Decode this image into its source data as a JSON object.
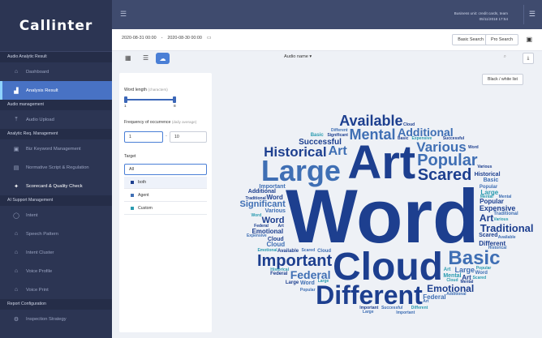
{
  "app": {
    "logo": "Callinter"
  },
  "topbar": {
    "user_line1": "Business unit: credit cards, team",
    "user_line2": "05/11/2018 17:54"
  },
  "sidebar": {
    "sections": [
      {
        "title": "Audio Analytic Result",
        "items": [
          {
            "label": "Dashboard",
            "icon": "home-icon",
            "glyph": "⌂"
          },
          {
            "label": "Analysis Result",
            "icon": "chart-icon",
            "glyph": "▟",
            "active": true
          }
        ]
      },
      {
        "title": "Audio management",
        "items": [
          {
            "label": "Audio Upload",
            "icon": "upload-icon",
            "glyph": "⤒"
          }
        ]
      },
      {
        "title": "Analytic Req. Management",
        "items": [
          {
            "label": "Biz Keyword Management",
            "icon": "keyword-icon",
            "glyph": "▣"
          },
          {
            "label": "Normative Script & Regulation",
            "icon": "script-icon",
            "glyph": "▤"
          },
          {
            "label": "Scorecard & Quality Check",
            "icon": "scorecard-icon",
            "glyph": "✦",
            "bright": true
          }
        ]
      },
      {
        "title": "AI Support Management",
        "items": [
          {
            "label": "Intent",
            "icon": "intent-icon",
            "glyph": "◯"
          },
          {
            "label": "Speech Pattern",
            "icon": "speech-pattern-icon",
            "glyph": "⌂"
          },
          {
            "label": "Intent Cluster",
            "icon": "cluster-icon",
            "glyph": "⌂"
          },
          {
            "label": "Voice Profile",
            "icon": "voice-profile-icon",
            "glyph": "⌂"
          },
          {
            "label": "Voice Print",
            "icon": "voice-print-icon",
            "glyph": "⌂"
          }
        ]
      },
      {
        "title": "Report Configuration",
        "items": [
          {
            "label": "Inspection Strategy",
            "icon": "strategy-icon",
            "glyph": "⚙"
          }
        ]
      }
    ]
  },
  "filter": {
    "date_from": "2020-08-31 00:00",
    "date_sep": "-",
    "date_to": "2020-08-30 00:00",
    "basic_search": "Basic Search",
    "pro_search": "Pro Search"
  },
  "toolbar": {
    "audio_select": "Audio name"
  },
  "panel": {
    "word_length_label": "Word length",
    "word_length_unit": "(characters)",
    "word_length_min": "1",
    "word_length_max": "8",
    "word_length_range": [
      0,
      1
    ],
    "freq_label": "Frequency of occurrence",
    "freq_unit": "(daily average)",
    "freq_from": "1",
    "freq_to": "10",
    "target_label": "Target",
    "target_value": "All",
    "target_options": [
      {
        "label": "both",
        "color": "#1d3f8f"
      },
      {
        "label": "Agent",
        "color": "#3f6fb4"
      },
      {
        "label": "Custom",
        "color": "#2a9bb0"
      }
    ]
  },
  "cloud_controls": {
    "bw_button": "Black / white list"
  },
  "colors": {
    "dark": "#1d3f8f",
    "mid": "#3f6fb4",
    "teal": "#2a9bb0",
    "accent": "#4a7fd6"
  },
  "word_cloud": [
    [
      "Word",
      94,
      "d"
    ],
    [
      "Art",
      58,
      "d"
    ],
    [
      "Cloud",
      48,
      "d"
    ],
    [
      "Large",
      36,
      "m"
    ],
    [
      "Different",
      32,
      "d"
    ],
    [
      "Popular",
      20,
      "m"
    ],
    [
      "Basic",
      24,
      "m"
    ],
    [
      "Scared",
      20,
      "d"
    ],
    [
      "Important",
      20,
      "d"
    ],
    [
      "Mental",
      18,
      "m"
    ],
    [
      "Various",
      17,
      "m"
    ],
    [
      "Historical",
      17,
      "d"
    ],
    [
      "Available",
      18,
      "d"
    ],
    [
      "Federal",
      14,
      "m"
    ],
    [
      "Emotional",
      12,
      "d"
    ],
    [
      "Art",
      16,
      "m"
    ],
    [
      "Additional",
      14,
      "m"
    ],
    [
      "Significant",
      11,
      "m"
    ],
    [
      "Traditional",
      13,
      "d"
    ],
    [
      "Word",
      11,
      "d"
    ],
    [
      "Successful",
      10,
      "d"
    ],
    [
      "Expensive",
      9,
      "d"
    ],
    [
      "Popular",
      8,
      "d"
    ],
    [
      "Emotional",
      8,
      "d"
    ],
    [
      "Art",
      12,
      "d"
    ],
    [
      "Large",
      9,
      "m"
    ],
    [
      "Cloud",
      8,
      "m"
    ],
    [
      "Different",
      8,
      "d"
    ],
    [
      "Word",
      8,
      "d"
    ],
    [
      "Mental",
      7,
      "t"
    ],
    [
      "Historical",
      7,
      "d"
    ],
    [
      "Various",
      7,
      "m"
    ],
    [
      "Large",
      8,
      "t"
    ],
    [
      "Federal",
      8,
      "m"
    ],
    [
      "Important",
      7,
      "m"
    ],
    [
      "Scared",
      7,
      "d"
    ],
    [
      "Basic",
      7,
      "m"
    ],
    [
      "Additional",
      7,
      "d"
    ],
    [
      "Word",
      7,
      "m"
    ],
    [
      "Cloud",
      7,
      "d"
    ],
    [
      "Art",
      8,
      "d"
    ],
    [
      "Popular",
      6,
      "m"
    ],
    [
      "Available",
      6,
      "d"
    ],
    [
      "Traditional",
      6,
      "m"
    ],
    [
      "Expensive",
      5,
      "t"
    ],
    [
      "Mental",
      5,
      "t"
    ],
    [
      "Significant",
      5,
      "d"
    ],
    [
      "Various",
      5,
      "d"
    ],
    [
      "Successful",
      5,
      "m"
    ],
    [
      "Cloud",
      6,
      "m"
    ],
    [
      "Art",
      6,
      "t"
    ],
    [
      "Word",
      6,
      "m"
    ],
    [
      "Federal",
      5,
      "d"
    ],
    [
      "Large",
      5,
      "t"
    ],
    [
      "Basic",
      5,
      "d"
    ],
    [
      "Popular",
      5,
      "m"
    ],
    [
      "Scared",
      5,
      "m"
    ],
    [
      "Historical",
      5,
      "m"
    ],
    [
      "Emotional",
      5,
      "t"
    ],
    [
      "Important",
      5,
      "d"
    ],
    [
      "Additional",
      5,
      "m"
    ],
    [
      "Different",
      5,
      "m"
    ],
    [
      "Mental",
      5,
      "m"
    ],
    [
      "Various",
      5,
      "t"
    ],
    [
      "Art",
      5,
      "d"
    ],
    [
      "Word",
      5,
      "t"
    ],
    [
      "Cloud",
      5,
      "t"
    ],
    [
      "Large",
      6,
      "d"
    ],
    [
      "Available",
      5,
      "m"
    ],
    [
      "Traditional",
      5,
      "d"
    ],
    [
      "Expensive",
      5,
      "m"
    ],
    [
      "Successful",
      5,
      "d"
    ],
    [
      "Federal",
      6,
      "d"
    ],
    [
      "Basic",
      6,
      "t"
    ],
    [
      "Popular",
      5,
      "t"
    ],
    [
      "Word",
      5,
      "d"
    ],
    [
      "Art",
      5,
      "m"
    ],
    [
      "Mental",
      5,
      "d"
    ],
    [
      "Historical",
      5,
      "t"
    ],
    [
      "Cloud",
      5,
      "d"
    ],
    [
      "Scared",
      5,
      "t"
    ],
    [
      "Important",
      5,
      "m"
    ],
    [
      "Large",
      5,
      "m"
    ],
    [
      "Different",
      5,
      "t"
    ]
  ]
}
